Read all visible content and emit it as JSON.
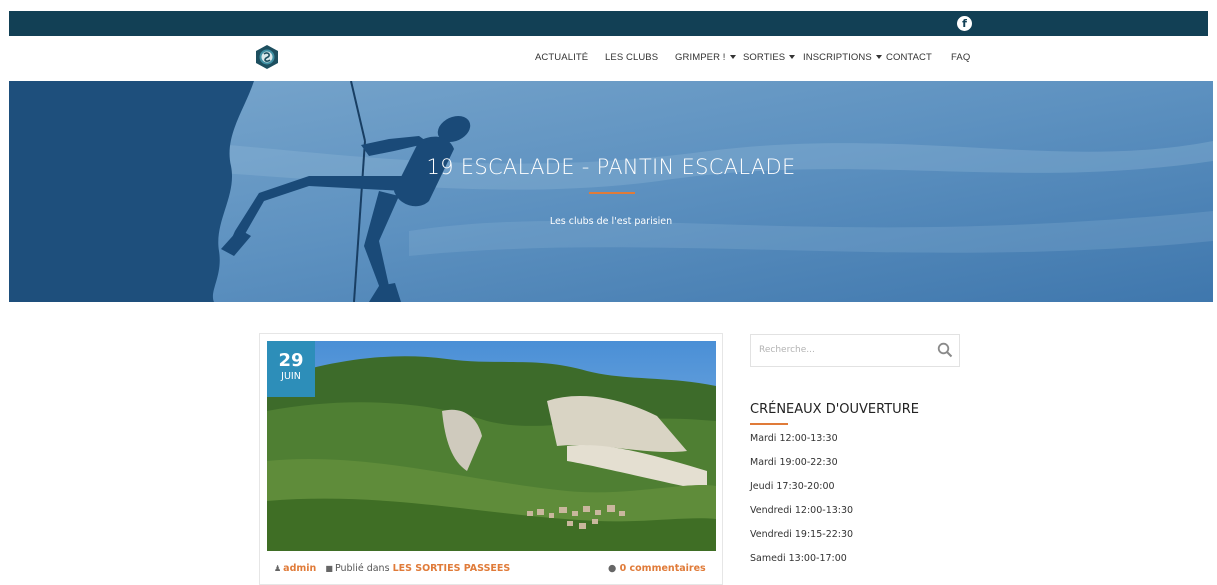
{
  "topbar": {
    "social_icon": "facebook-icon",
    "color": "#124055"
  },
  "nav": {
    "logo_icon": "club-logo-icon",
    "items": [
      {
        "label": "ACTUALITÉ",
        "dropdown": false
      },
      {
        "label": "LES CLUBS",
        "dropdown": false
      },
      {
        "label": "GRIMPER !",
        "dropdown": true
      },
      {
        "label": "SORTIES",
        "dropdown": true
      },
      {
        "label": "INSCRIPTIONS",
        "dropdown": true
      },
      {
        "label": "CONTACT",
        "dropdown": false
      },
      {
        "label": "FAQ",
        "dropdown": false
      }
    ]
  },
  "hero": {
    "title": "19 ESCALADE - PANTIN ESCALADE",
    "subtitle": "Les clubs de l'est parisien",
    "accent": "#e07b39"
  },
  "post": {
    "date_day": "29",
    "date_month": "JUIN",
    "author": "admin",
    "published_in_label": "Publié dans",
    "category": "LES SORTIES PASSEES",
    "comments": "0 commentaires",
    "badge_color": "#2d8eb9"
  },
  "sidebar": {
    "search_placeholder": "Recherche...",
    "widget_title": "CRÉNEAUX D'OUVERTURE",
    "slots": [
      "Mardi 12:00-13:30",
      "Mardi 19:00-22:30",
      "Jeudi 17:30-20:00",
      "Vendredi 12:00-13:30",
      "Vendredi 19:15-22:30",
      "Samedi 13:00-17:00"
    ]
  }
}
